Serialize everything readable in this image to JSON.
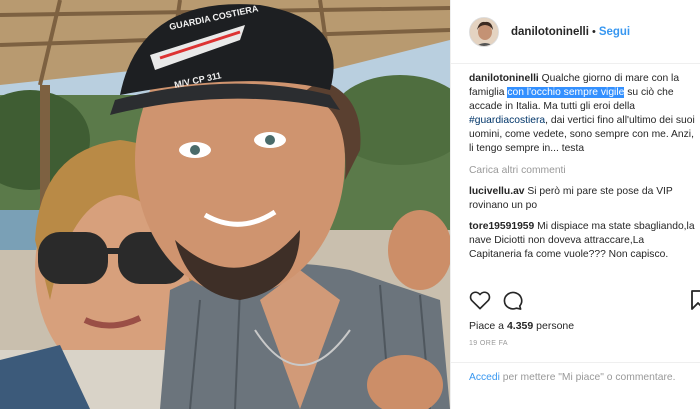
{
  "post": {
    "username": "danilotoninelli",
    "separator": "•",
    "follow_label": "Segui",
    "caption_user": "danilotoninelli",
    "caption": {
      "part1": "Qualche giorno di mare con la famiglia ",
      "highlight": "con l'occhio sempre vigile",
      "part2": " su ciò che accade in Italia. Ma tutti gli eroi della ",
      "hashtag": "#guardiacostiera",
      "part3": ", dai vertici fino all'ultimo dei suoi uomini, come vedete, sono sempre con me. Anzi, li tengo sempre in... testa"
    },
    "load_more": "Carica altri commenti",
    "comments": [
      {
        "user": "lucivellu.av",
        "text": "Si però mi pare ste pose da VIP rovinano un po"
      },
      {
        "user": "tore19591959",
        "text": "Mi dispiace ma state sbagliando,la nave Diciotti non doveva attraccare,La Capitaneria fa come vuole??? Non capisco."
      }
    ],
    "likes_prefix": "Piace a ",
    "likes_count": "4.359",
    "likes_suffix": " persone",
    "time_ago": "19 ORE FA",
    "footer": {
      "login": "Accedi",
      "rest": " per mettere \"Mi piace\" o commentare."
    }
  },
  "photo": {
    "cap_text_top": "GUARDIA COSTIERA",
    "cap_text_bottom": "M/V CP 311"
  },
  "icons": {
    "like": "heart-icon",
    "comment": "comment-icon",
    "share": "share-icon"
  },
  "colors": {
    "link": "#3897f0",
    "highlight": "#3390ff",
    "text": "#262626",
    "muted": "#999999"
  }
}
